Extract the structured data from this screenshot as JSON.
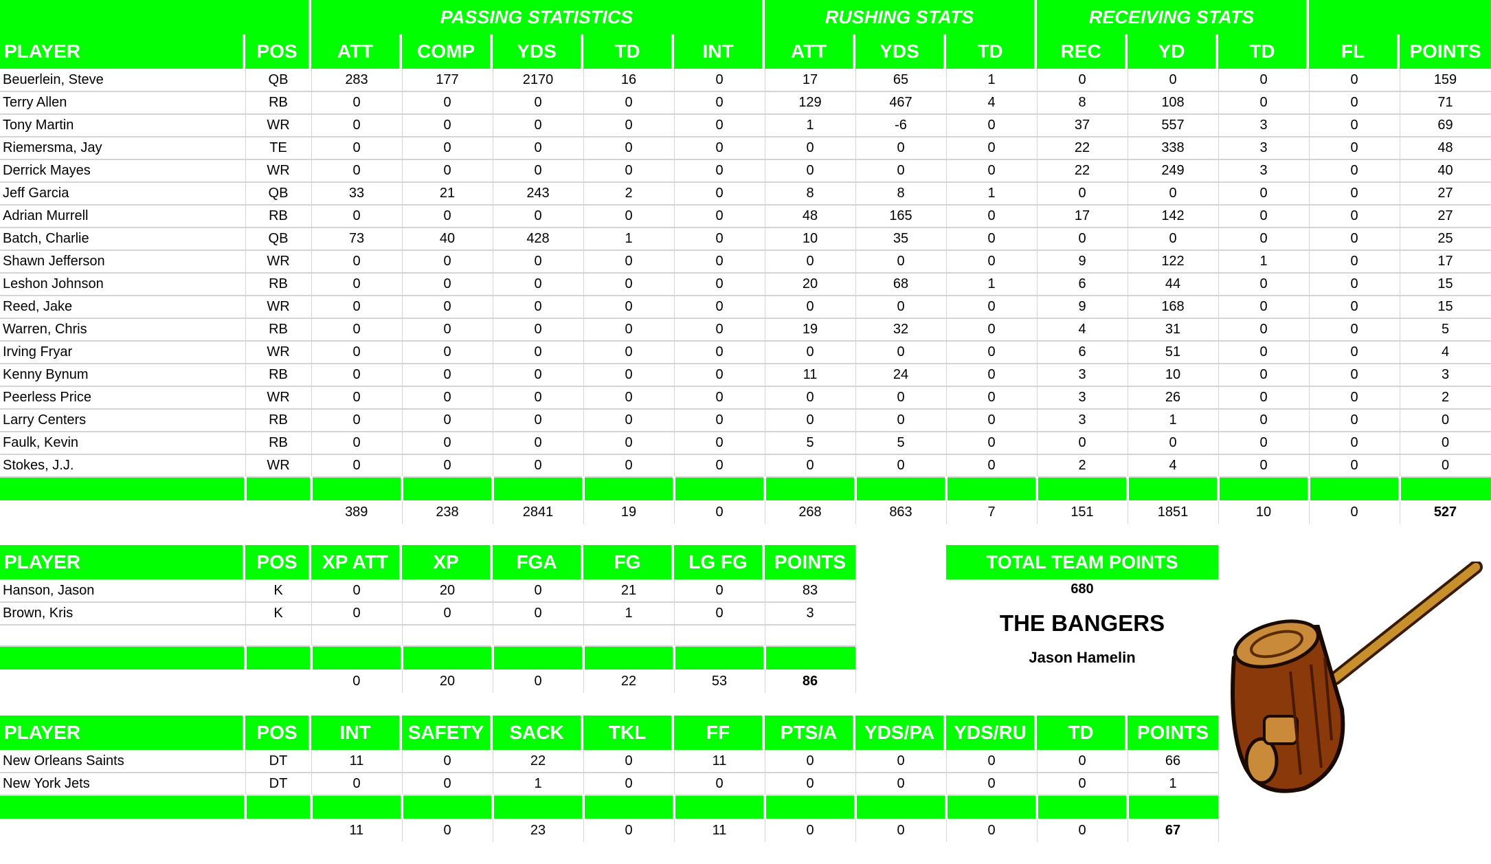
{
  "offense": {
    "group_headers": {
      "passing": "PASSING STATISTICS",
      "rushing": "RUSHING STATS",
      "receiving": "RECEIVING STATS"
    },
    "columns": [
      "PLAYER",
      "POS",
      "ATT",
      "COMP",
      "YDS",
      "TD",
      "INT",
      "ATT",
      "YDS",
      "TD",
      "REC",
      "YD",
      "TD",
      "FL",
      "POINTS"
    ],
    "rows": [
      [
        "Beuerlein, Steve",
        "QB",
        "283",
        "177",
        "2170",
        "16",
        "0",
        "17",
        "65",
        "1",
        "0",
        "0",
        "0",
        "0",
        "159"
      ],
      [
        "Terry Allen",
        "RB",
        "0",
        "0",
        "0",
        "0",
        "0",
        "129",
        "467",
        "4",
        "8",
        "108",
        "0",
        "0",
        "71"
      ],
      [
        "Tony Martin",
        "WR",
        "0",
        "0",
        "0",
        "0",
        "0",
        "1",
        "-6",
        "0",
        "37",
        "557",
        "3",
        "0",
        "69"
      ],
      [
        "Riemersma, Jay",
        "TE",
        "0",
        "0",
        "0",
        "0",
        "0",
        "0",
        "0",
        "0",
        "22",
        "338",
        "3",
        "0",
        "48"
      ],
      [
        "Derrick Mayes",
        "WR",
        "0",
        "0",
        "0",
        "0",
        "0",
        "0",
        "0",
        "0",
        "22",
        "249",
        "3",
        "0",
        "40"
      ],
      [
        "Jeff Garcia",
        "QB",
        "33",
        "21",
        "243",
        "2",
        "0",
        "8",
        "8",
        "1",
        "0",
        "0",
        "0",
        "0",
        "27"
      ],
      [
        "Adrian Murrell",
        "RB",
        "0",
        "0",
        "0",
        "0",
        "0",
        "48",
        "165",
        "0",
        "17",
        "142",
        "0",
        "0",
        "27"
      ],
      [
        "Batch, Charlie",
        "QB",
        "73",
        "40",
        "428",
        "1",
        "0",
        "10",
        "35",
        "0",
        "0",
        "0",
        "0",
        "0",
        "25"
      ],
      [
        "Shawn Jefferson",
        "WR",
        "0",
        "0",
        "0",
        "0",
        "0",
        "0",
        "0",
        "0",
        "9",
        "122",
        "1",
        "0",
        "17"
      ],
      [
        "Leshon Johnson",
        "RB",
        "0",
        "0",
        "0",
        "0",
        "0",
        "20",
        "68",
        "1",
        "6",
        "44",
        "0",
        "0",
        "15"
      ],
      [
        "Reed, Jake",
        "WR",
        "0",
        "0",
        "0",
        "0",
        "0",
        "0",
        "0",
        "0",
        "9",
        "168",
        "0",
        "0",
        "15"
      ],
      [
        "Warren, Chris",
        "RB",
        "0",
        "0",
        "0",
        "0",
        "0",
        "19",
        "32",
        "0",
        "4",
        "31",
        "0",
        "0",
        "5"
      ],
      [
        "Irving Fryar",
        "WR",
        "0",
        "0",
        "0",
        "0",
        "0",
        "0",
        "0",
        "0",
        "6",
        "51",
        "0",
        "0",
        "4"
      ],
      [
        "Kenny Bynum",
        "RB",
        "0",
        "0",
        "0",
        "0",
        "0",
        "11",
        "24",
        "0",
        "3",
        "10",
        "0",
        "0",
        "3"
      ],
      [
        "Peerless Price",
        "WR",
        "0",
        "0",
        "0",
        "0",
        "0",
        "0",
        "0",
        "0",
        "3",
        "26",
        "0",
        "0",
        "2"
      ],
      [
        "Larry Centers",
        "RB",
        "0",
        "0",
        "0",
        "0",
        "0",
        "0",
        "0",
        "0",
        "3",
        "1",
        "0",
        "0",
        "0"
      ],
      [
        "Faulk, Kevin",
        "RB",
        "0",
        "0",
        "0",
        "0",
        "0",
        "5",
        "5",
        "0",
        "0",
        "0",
        "0",
        "0",
        "0"
      ],
      [
        "Stokes, J.J.",
        "WR",
        "0",
        "0",
        "0",
        "0",
        "0",
        "0",
        "0",
        "0",
        "2",
        "4",
        "0",
        "0",
        "0"
      ]
    ],
    "totals": [
      "",
      "",
      "389",
      "238",
      "2841",
      "19",
      "0",
      "268",
      "863",
      "7",
      "151",
      "1851",
      "10",
      "0",
      "527"
    ]
  },
  "kickers": {
    "columns": [
      "PLAYER",
      "POS",
      "XP ATT",
      "XP",
      "FGA",
      "FG",
      "LG FG",
      "POINTS"
    ],
    "rows": [
      [
        "Hanson, Jason",
        "K",
        "0",
        "20",
        "0",
        "21",
        "0",
        "83"
      ],
      [
        "Brown, Kris",
        "K",
        "0",
        "0",
        "0",
        "1",
        "0",
        "3"
      ]
    ],
    "totals": [
      "",
      "",
      "0",
      "20",
      "0",
      "22",
      "53",
      "86"
    ]
  },
  "defense": {
    "columns": [
      "PLAYER",
      "POS",
      "INT",
      "SAFETY",
      "SACK",
      "TKL",
      "FF",
      "PTS/A",
      "YDS/PA",
      "YDS/RU",
      "TD",
      "POINTS"
    ],
    "rows": [
      [
        "New Orleans Saints",
        "DT",
        "11",
        "0",
        "22",
        "0",
        "11",
        "0",
        "0",
        "0",
        "0",
        "66"
      ],
      [
        "New York Jets",
        "DT",
        "0",
        "0",
        "1",
        "0",
        "0",
        "0",
        "0",
        "0",
        "0",
        "1"
      ]
    ],
    "totals": [
      "",
      "",
      "11",
      "0",
      "23",
      "0",
      "11",
      "0",
      "0",
      "0",
      "0",
      "67"
    ]
  },
  "team": {
    "total_label": "TOTAL TEAM POINTS",
    "total_points": "680",
    "name": "THE BANGERS",
    "owner": "Jason Hamelin",
    "logo_icon": "mallet-icon"
  },
  "colors": {
    "header_green": "#00ff00",
    "header_text": "#ffffff",
    "grid_line": "#d4d4d4"
  }
}
